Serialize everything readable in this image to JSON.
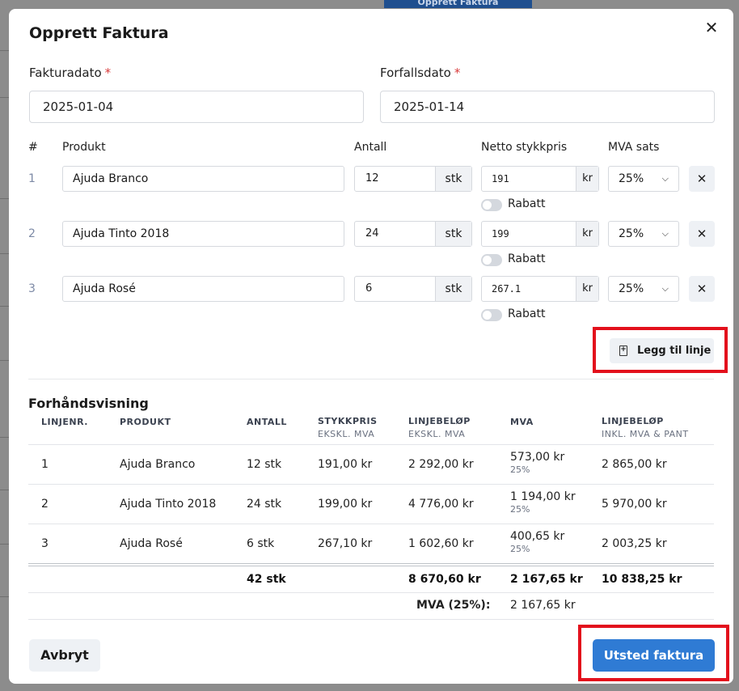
{
  "background": {
    "top_button_label": "Opprett Faktura"
  },
  "modal": {
    "title": "Opprett Faktura",
    "close_icon": "close-icon",
    "invoice_date": {
      "label": "Fakturadato",
      "required": "*",
      "value": "2025-01-04"
    },
    "due_date": {
      "label": "Forfallsdato",
      "required": "*",
      "value": "2025-01-14"
    },
    "lines_header": {
      "num": "#",
      "product": "Produkt",
      "qty": "Antall",
      "price": "Netto stykkpris",
      "vat": "MVA sats"
    },
    "lines": [
      {
        "num": "1",
        "product": "Ajuda Branco",
        "qty": "12",
        "unit": "stk",
        "price": "191",
        "currency": "kr",
        "vat": "25%",
        "discount_label": "Rabatt",
        "discount_on": false
      },
      {
        "num": "2",
        "product": "Ajuda Tinto 2018",
        "qty": "24",
        "unit": "stk",
        "price": "199",
        "currency": "kr",
        "vat": "25%",
        "discount_label": "Rabatt",
        "discount_on": false
      },
      {
        "num": "3",
        "product": "Ajuda Rosé",
        "qty": "6",
        "unit": "stk",
        "price": "267.1",
        "currency": "kr",
        "vat": "25%",
        "discount_label": "Rabatt",
        "discount_on": false
      }
    ],
    "add_line_label": "Legg til linje",
    "preview": {
      "title": "Forhåndsvisning",
      "headers": {
        "line_no": "LINJENR.",
        "product": "PRODUKT",
        "qty": "ANTALL",
        "unit_price": "STYKKPRIS",
        "unit_price_sub": "EKSKL. MVA",
        "line_amount": "LINJEBELØP",
        "line_amount_sub": "EKSKL. MVA",
        "vat": "MVA",
        "line_total": "LINJEBELØP",
        "line_total_sub": "INKL. MVA & PANT"
      },
      "rows": [
        {
          "line_no": "1",
          "product": "Ajuda Branco",
          "qty": "12 stk",
          "unit_price": "191,00 kr",
          "line_amount": "2 292,00 kr",
          "vat": "573,00 kr",
          "vat_rate": "25%",
          "line_total": "2 865,00 kr"
        },
        {
          "line_no": "2",
          "product": "Ajuda Tinto 2018",
          "qty": "24 stk",
          "unit_price": "199,00 kr",
          "line_amount": "4 776,00 kr",
          "vat": "1 194,00 kr",
          "vat_rate": "25%",
          "line_total": "5 970,00 kr"
        },
        {
          "line_no": "3",
          "product": "Ajuda Rosé",
          "qty": "6 stk",
          "unit_price": "267,10 kr",
          "line_amount": "1 602,60 kr",
          "vat": "400,65 kr",
          "vat_rate": "25%",
          "line_total": "2 003,25 kr"
        }
      ],
      "totals": {
        "qty": "42 stk",
        "line_amount": "8 670,60 kr",
        "vat": "2 167,65 kr",
        "line_total": "10 838,25 kr"
      },
      "vat_summary": {
        "label": "MVA (25%):",
        "value": "2 167,65 kr"
      }
    },
    "cancel_label": "Avbryt",
    "issue_label": "Utsted faktura"
  }
}
